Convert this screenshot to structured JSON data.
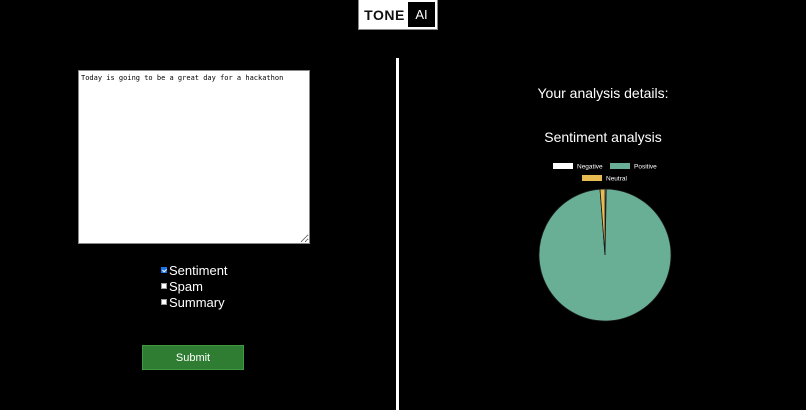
{
  "logo": {
    "part1": "TONE",
    "part2": "AI"
  },
  "input": {
    "value": "Today is going to be a great day for a hackathon"
  },
  "options": [
    {
      "label": "Sentiment",
      "checked": true
    },
    {
      "label": "Spam",
      "checked": false
    },
    {
      "label": "Summary",
      "checked": false
    }
  ],
  "submit_label": "Submit",
  "analysis_title": "Your analysis details:",
  "chart_title": "Sentiment analysis",
  "colors": {
    "negative": "#ffffff",
    "positive": "#69af96",
    "neutral": "#e6bb52",
    "submit": "#2f7d32"
  },
  "chart_data": {
    "type": "pie",
    "title": "Sentiment analysis",
    "legend_position": "top",
    "categories": [
      "Negative",
      "Positive",
      "Neutral"
    ],
    "values": [
      0.3,
      98.5,
      1.2
    ],
    "colors": [
      "#ffffff",
      "#69af96",
      "#e6bb52"
    ]
  }
}
